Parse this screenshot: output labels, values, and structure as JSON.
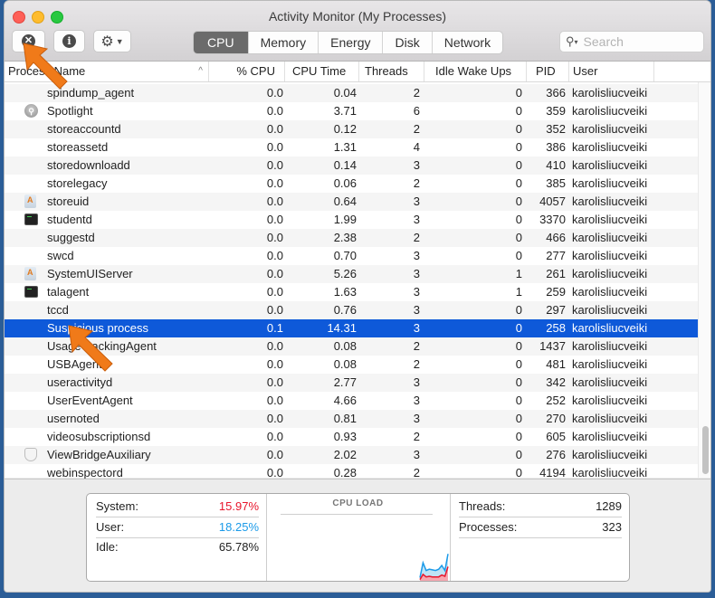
{
  "window": {
    "title": "Activity Monitor (My Processes)"
  },
  "toolbar": {
    "stop_icon": "x-circle-icon",
    "info_icon": "info-icon",
    "gear_icon": "gear-icon",
    "tabs": [
      {
        "label": "CPU",
        "active": true
      },
      {
        "label": "Memory",
        "active": false
      },
      {
        "label": "Energy",
        "active": false
      },
      {
        "label": "Disk",
        "active": false
      },
      {
        "label": "Network",
        "active": false
      }
    ],
    "search_placeholder": "Search"
  },
  "table": {
    "columns": [
      "Process Name",
      "% CPU",
      "CPU Time",
      "Threads",
      "Idle Wake Ups",
      "PID",
      "User"
    ],
    "sort_indicator": "^",
    "rows": [
      {
        "name": "spindump_agent",
        "icon": "",
        "cpu": "0.0",
        "time": "0.04",
        "threads": "2",
        "idle": "0",
        "pid": "366",
        "user": "karolisliucveiki"
      },
      {
        "name": "Spotlight",
        "icon": "spotlight",
        "cpu": "0.0",
        "time": "3.71",
        "threads": "6",
        "idle": "0",
        "pid": "359",
        "user": "karolisliucveiki"
      },
      {
        "name": "storeaccountd",
        "icon": "",
        "cpu": "0.0",
        "time": "0.12",
        "threads": "2",
        "idle": "0",
        "pid": "352",
        "user": "karolisliucveiki"
      },
      {
        "name": "storeassetd",
        "icon": "",
        "cpu": "0.0",
        "time": "1.31",
        "threads": "4",
        "idle": "0",
        "pid": "386",
        "user": "karolisliucveiki"
      },
      {
        "name": "storedownloadd",
        "icon": "",
        "cpu": "0.0",
        "time": "0.14",
        "threads": "3",
        "idle": "0",
        "pid": "410",
        "user": "karolisliucveiki"
      },
      {
        "name": "storelegacy",
        "icon": "",
        "cpu": "0.0",
        "time": "0.06",
        "threads": "2",
        "idle": "0",
        "pid": "385",
        "user": "karolisliucveiki"
      },
      {
        "name": "storeuid",
        "icon": "app",
        "cpu": "0.0",
        "time": "0.64",
        "threads": "3",
        "idle": "0",
        "pid": "4057",
        "user": "karolisliucveiki"
      },
      {
        "name": "studentd",
        "icon": "terminal",
        "cpu": "0.0",
        "time": "1.99",
        "threads": "3",
        "idle": "0",
        "pid": "3370",
        "user": "karolisliucveiki"
      },
      {
        "name": "suggestd",
        "icon": "",
        "cpu": "0.0",
        "time": "2.38",
        "threads": "2",
        "idle": "0",
        "pid": "466",
        "user": "karolisliucveiki"
      },
      {
        "name": "swcd",
        "icon": "",
        "cpu": "0.0",
        "time": "0.70",
        "threads": "3",
        "idle": "0",
        "pid": "277",
        "user": "karolisliucveiki"
      },
      {
        "name": "SystemUIServer",
        "icon": "app",
        "cpu": "0.0",
        "time": "5.26",
        "threads": "3",
        "idle": "1",
        "pid": "261",
        "user": "karolisliucveiki"
      },
      {
        "name": "talagent",
        "icon": "terminal",
        "cpu": "0.0",
        "time": "1.63",
        "threads": "3",
        "idle": "1",
        "pid": "259",
        "user": "karolisliucveiki"
      },
      {
        "name": "tccd",
        "icon": "",
        "cpu": "0.0",
        "time": "0.76",
        "threads": "3",
        "idle": "0",
        "pid": "297",
        "user": "karolisliucveiki"
      },
      {
        "name": "Suspicious process",
        "icon": "",
        "cpu": "0.1",
        "time": "14.31",
        "threads": "3",
        "idle": "0",
        "pid": "258",
        "user": "karolisliucveiki",
        "selected": true
      },
      {
        "name": "UsageTrackingAgent",
        "icon": "",
        "cpu": "0.0",
        "time": "0.08",
        "threads": "2",
        "idle": "0",
        "pid": "1437",
        "user": "karolisliucveiki"
      },
      {
        "name": "USBAgent",
        "icon": "",
        "cpu": "0.0",
        "time": "0.08",
        "threads": "2",
        "idle": "0",
        "pid": "481",
        "user": "karolisliucveiki"
      },
      {
        "name": "useractivityd",
        "icon": "",
        "cpu": "0.0",
        "time": "2.77",
        "threads": "3",
        "idle": "0",
        "pid": "342",
        "user": "karolisliucveiki"
      },
      {
        "name": "UserEventAgent",
        "icon": "",
        "cpu": "0.0",
        "time": "4.66",
        "threads": "3",
        "idle": "0",
        "pid": "252",
        "user": "karolisliucveiki"
      },
      {
        "name": "usernoted",
        "icon": "",
        "cpu": "0.0",
        "time": "0.81",
        "threads": "3",
        "idle": "0",
        "pid": "270",
        "user": "karolisliucveiki"
      },
      {
        "name": "videosubscriptionsd",
        "icon": "",
        "cpu": "0.0",
        "time": "0.93",
        "threads": "2",
        "idle": "0",
        "pid": "605",
        "user": "karolisliucveiki"
      },
      {
        "name": "ViewBridgeAuxiliary",
        "icon": "shield",
        "cpu": "0.0",
        "time": "2.02",
        "threads": "3",
        "idle": "0",
        "pid": "276",
        "user": "karolisliucveiki"
      },
      {
        "name": "webinspectord",
        "icon": "",
        "cpu": "0.0",
        "time": "0.28",
        "threads": "2",
        "idle": "0",
        "pid": "4194",
        "user": "karolisliucveiki"
      }
    ]
  },
  "summary": {
    "system_label": "System:",
    "system_value": "15.97%",
    "user_label": "User:",
    "user_value": "18.25%",
    "idle_label": "Idle:",
    "idle_value": "65.78%",
    "cpu_load_title": "CPU LOAD",
    "threads_label": "Threads:",
    "threads_value": "1289",
    "processes_label": "Processes:",
    "processes_value": "323",
    "colors": {
      "system": "#e8152b",
      "user": "#1b9ae8"
    },
    "cpu_load_recent": {
      "user_plus_system": [
        0.05,
        0.28,
        0.16,
        0.18,
        0.17,
        0.16,
        0.18,
        0.24,
        0.16,
        0.42
      ],
      "system": [
        0.02,
        0.1,
        0.06,
        0.07,
        0.06,
        0.06,
        0.06,
        0.09,
        0.07,
        0.22
      ]
    }
  }
}
